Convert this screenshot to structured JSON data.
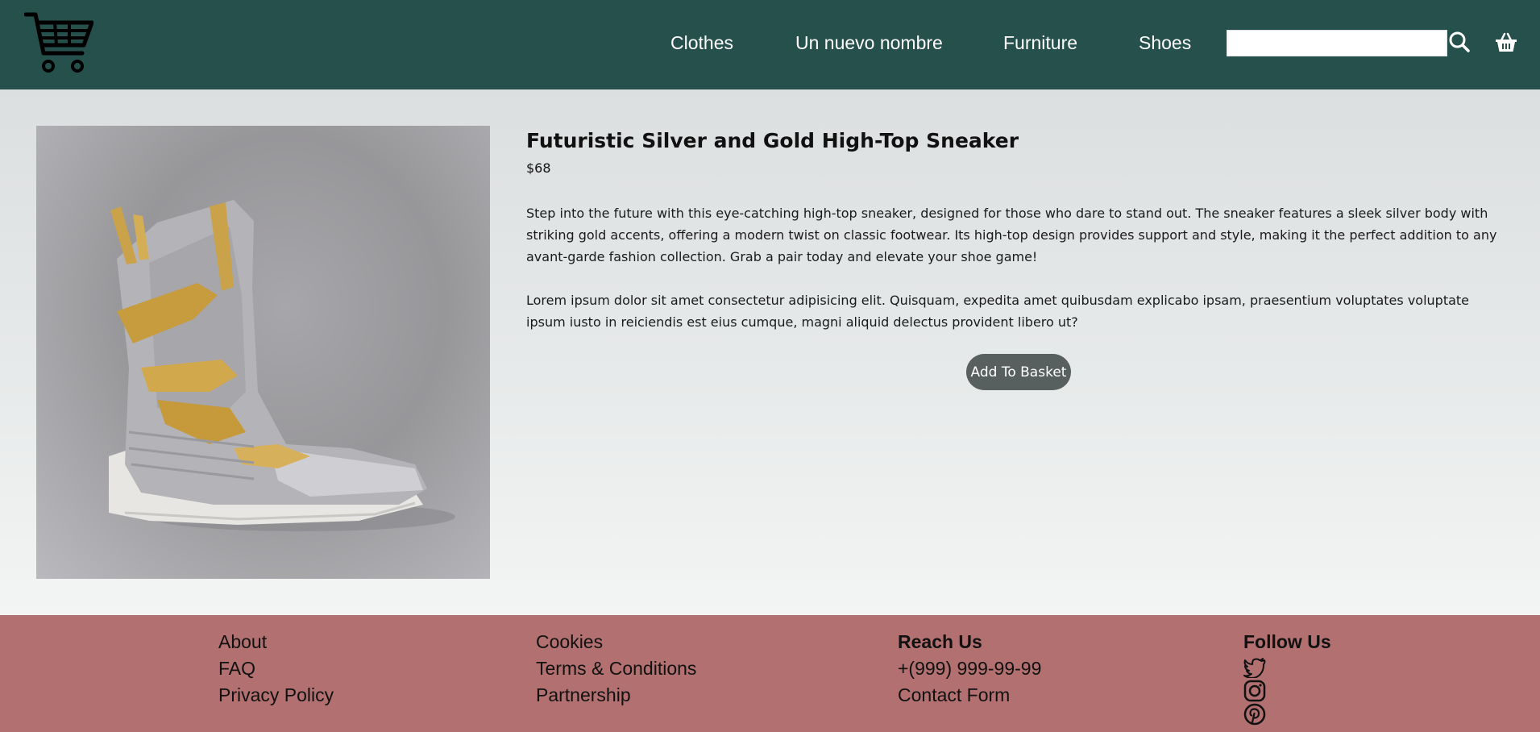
{
  "header": {
    "nav": [
      {
        "label": "Clothes"
      },
      {
        "label": "Un nuevo nombre"
      },
      {
        "label": "Furniture"
      },
      {
        "label": "Shoes"
      }
    ],
    "search": {
      "value": "",
      "placeholder": ""
    },
    "icons": {
      "logo": "shopping-cart-icon",
      "search": "search-icon",
      "basket": "basket-icon"
    }
  },
  "product": {
    "title": "Futuristic Silver and Gold High-Top Sneaker",
    "price": "$68",
    "description": "Step into the future with this eye-catching high-top sneaker, designed for those who dare to stand out. The sneaker features a sleek silver body with striking gold accents, offering a modern twist on classic footwear. Its high-top design provides support and style, making it the perfect addition to any avant-garde fashion collection. Grab a pair today and elevate your shoe game!",
    "extra": "Lorem ipsum dolor sit amet consectetur adipisicing elit. Quisquam, expedita amet quibusdam explicabo ipsam, praesentium voluptates voluptate ipsum iusto in reiciendis est eius cumque, magni aliquid delectus provident libero ut?",
    "add_button": "Add To Basket"
  },
  "footer": {
    "col1": [
      "About",
      "FAQ",
      "Privacy Policy"
    ],
    "col2": [
      "Cookies",
      "Terms & Conditions",
      "Partnership"
    ],
    "reach": {
      "heading": "Reach Us",
      "phone": "+(999) 999-99-99",
      "contact": "Contact Form"
    },
    "follow": {
      "heading": "Follow Us",
      "icons": [
        "twitter-icon",
        "instagram-icon",
        "pinterest-icon"
      ]
    }
  },
  "colors": {
    "header_bg": "#26504b",
    "footer_bg": "#b27070",
    "button_bg": "#575f5f"
  }
}
